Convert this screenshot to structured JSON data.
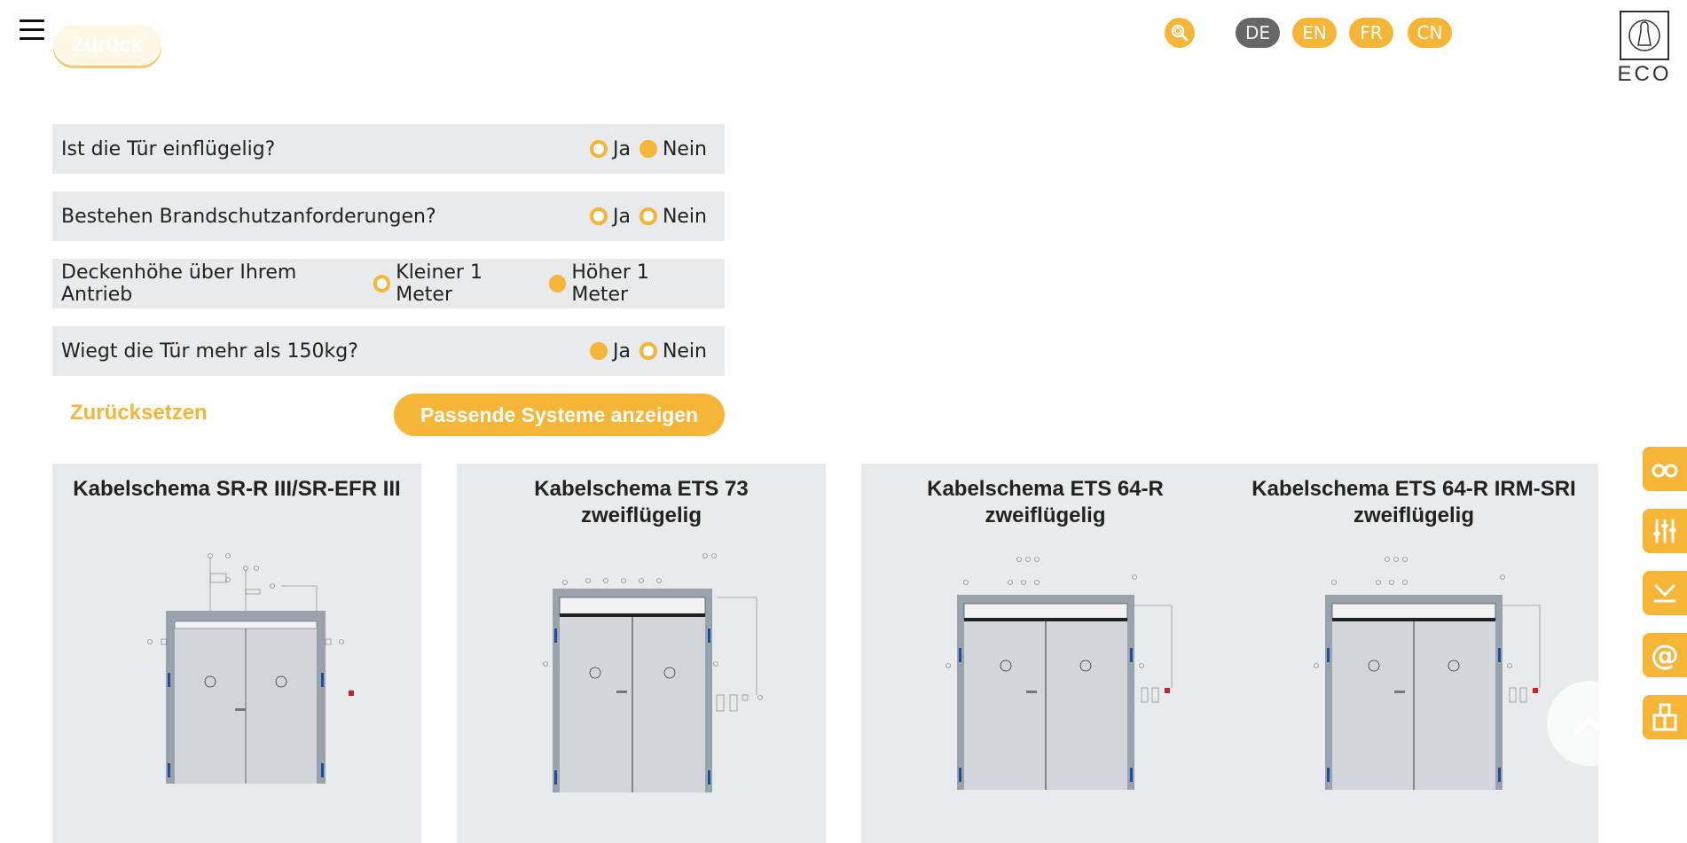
{
  "header": {
    "back_label": "Zurück",
    "languages": [
      {
        "code": "DE",
        "active": true
      },
      {
        "code": "EN",
        "active": false
      },
      {
        "code": "FR",
        "active": false
      },
      {
        "code": "CN",
        "active": false
      }
    ],
    "logo_text": "ECO"
  },
  "questions": [
    {
      "label": "Ist die Tür einflügelig?",
      "options": [
        {
          "label": "Ja",
          "checked": false
        },
        {
          "label": "Nein",
          "checked": true
        }
      ]
    },
    {
      "label": "Bestehen Brandschutzanforderungen?",
      "options": [
        {
          "label": "Ja",
          "checked": false
        },
        {
          "label": "Nein",
          "checked": false
        }
      ]
    },
    {
      "label": "Deckenhöhe über Ihrem Antrieb",
      "options": [
        {
          "label": "Kleiner 1 Meter",
          "checked": false
        },
        {
          "label": "Höher 1 Meter",
          "checked": true
        }
      ]
    },
    {
      "label": "Wiegt die Tür mehr als 150kg?",
      "options": [
        {
          "label": "Ja",
          "checked": true
        },
        {
          "label": "Nein",
          "checked": false
        }
      ]
    }
  ],
  "actions": {
    "reset_label": "Zurücksetzen",
    "show_label": "Passende Systeme anzeigen"
  },
  "cards": [
    {
      "title_line1": "Kabelschema SR-R III/SR-EFR III",
      "title_line2": ""
    },
    {
      "title_line1": "Kabelschema ETS 73",
      "title_line2": "zweiflügelig"
    },
    {
      "title_line1": "Kabelschema ETS 64-R",
      "title_line2": "zweiflügelig"
    },
    {
      "title_line1": "Kabelschema ETS 64-R IRM-SRI",
      "title_line2": "zweiflügelig"
    }
  ],
  "sidebar": [
    "binoculars-icon",
    "sliders-icon",
    "download-icon",
    "at-icon",
    "contact-icon"
  ],
  "colors": {
    "accent": "#f5b537",
    "panel": "#e8eaeb",
    "active_lang": "#666666"
  }
}
